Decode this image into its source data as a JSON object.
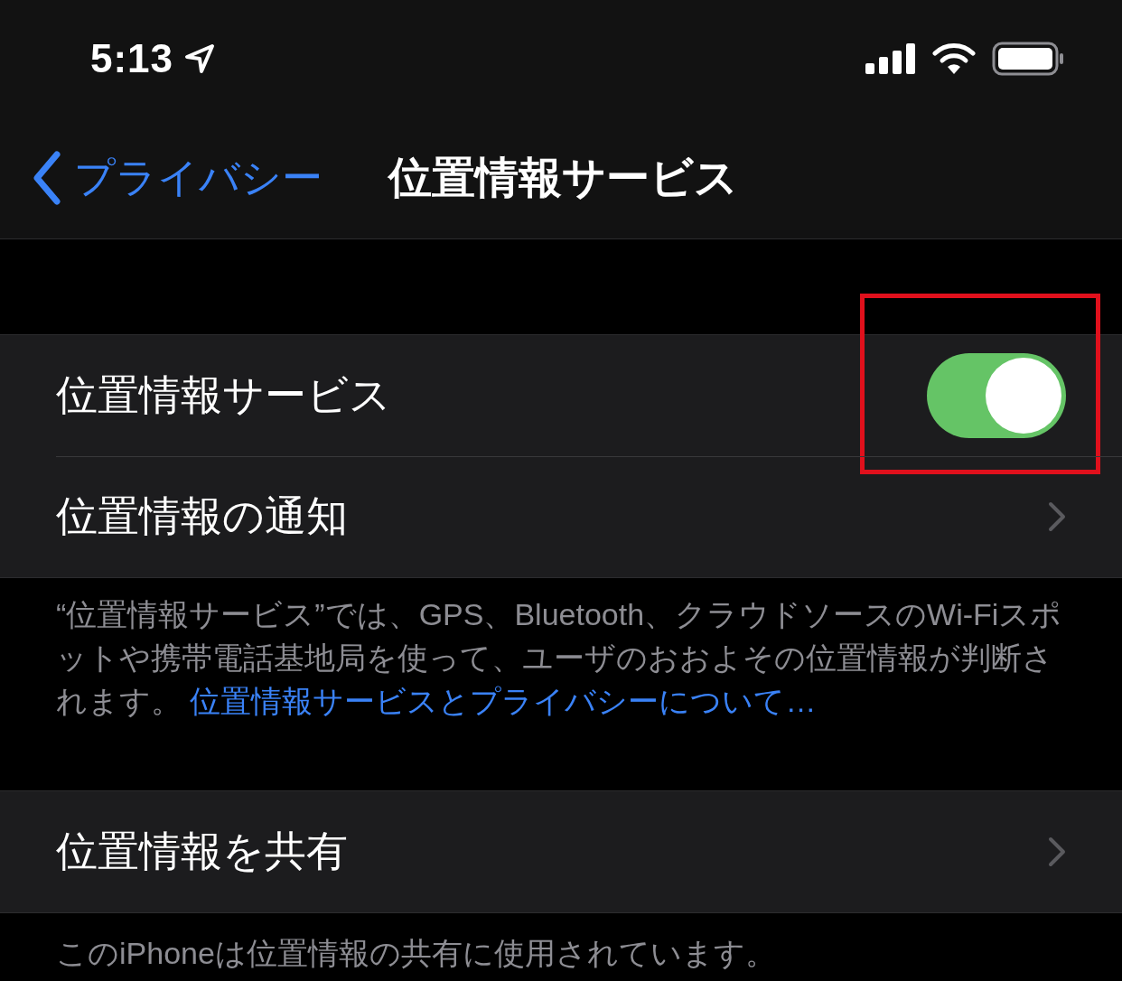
{
  "status_bar": {
    "time": "5:13",
    "location_active": true
  },
  "nav": {
    "back_label": "プライバシー",
    "title": "位置情報サービス"
  },
  "sections": [
    {
      "rows": [
        {
          "kind": "toggle",
          "label": "位置情報サービス",
          "on": true,
          "highlighted": true
        },
        {
          "kind": "link",
          "label": "位置情報の通知"
        }
      ],
      "footer": {
        "text": "“位置情報サービス”では、GPS、Bluetooth、クラウドソースのWi-Fiスポットや携帯電話基地局を使って、ユーザのおおよその位置情報が判断されます。",
        "link": "位置情報サービスとプライバシーについて…"
      }
    },
    {
      "rows": [
        {
          "kind": "link",
          "label": "位置情報を共有"
        }
      ],
      "footer": {
        "text": "このiPhoneは位置情報の共有に使用されています。"
      }
    }
  ]
}
